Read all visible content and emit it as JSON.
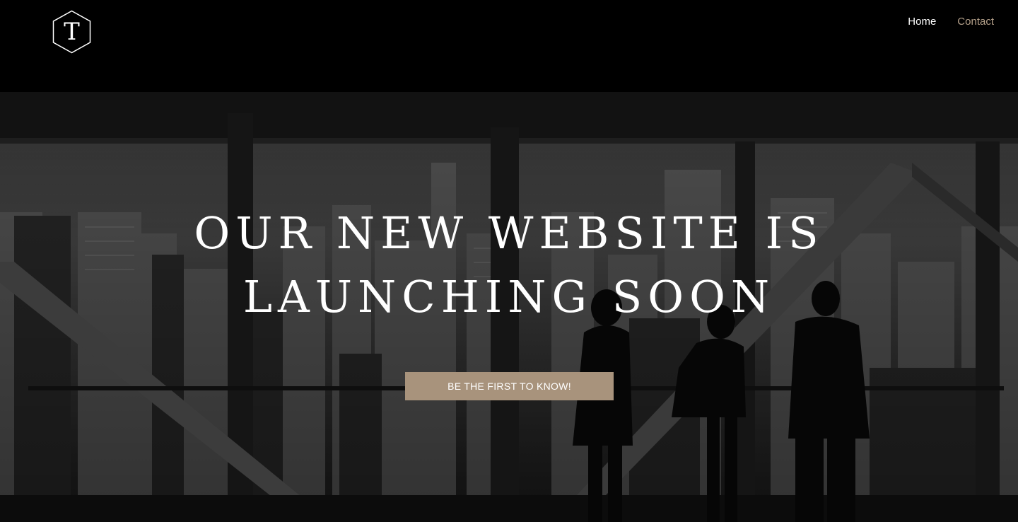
{
  "brand": {
    "logo_letter": "T",
    "accent_color": "#a8937c",
    "background_color": "#000000"
  },
  "nav": {
    "items": [
      {
        "label": "Home",
        "state": "active"
      },
      {
        "label": "Contact",
        "state": "inactive"
      }
    ]
  },
  "hero": {
    "title": "OUR NEW WEBSITE IS LAUNCHING SOON",
    "cta_label": "BE THE FIRST TO KNOW!"
  }
}
